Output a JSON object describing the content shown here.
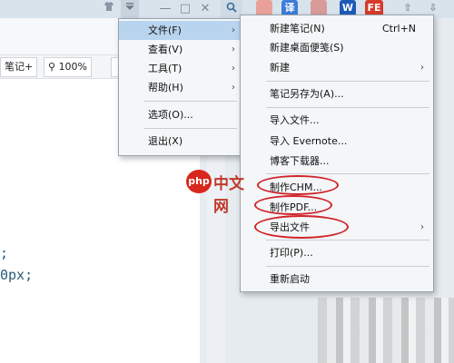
{
  "titlebar": {
    "buttons": [
      "shirt-icon",
      "dropdown-menu-icon",
      "minimize-icon",
      "maximize-icon",
      "close-icon"
    ],
    "minimize_glyph": "—",
    "maximize_glyph": "□",
    "close_glyph": "✕",
    "search_glyph": "🔍",
    "apps": [
      {
        "name": "translate",
        "text": "译",
        "color": "#3b7dd8"
      },
      {
        "name": "word",
        "text": "W",
        "color": "#1e5bb8"
      },
      {
        "name": "flash",
        "text": "FE",
        "color": "#d63b2a"
      }
    ]
  },
  "toolbar": {
    "note_label": "笔记+",
    "zoom_label": "100%",
    "zoom_icon": "🔍"
  },
  "editor": {
    "lines": [
      ";",
      "0px;"
    ]
  },
  "main_menu": {
    "items": [
      {
        "label": "文件(F)",
        "submenu": true,
        "highlight": true
      },
      {
        "label": "查看(V)",
        "submenu": true
      },
      {
        "label": "工具(T)",
        "submenu": true
      },
      {
        "label": "帮助(H)",
        "submenu": true
      },
      {
        "label": "选项(O)...",
        "submenu": false
      },
      {
        "label": "退出(X)",
        "submenu": false
      }
    ]
  },
  "file_menu": {
    "items": [
      {
        "label": "新建笔记(N)",
        "shortcut": "Ctrl+N"
      },
      {
        "label": "新建桌面便笺(S)"
      },
      {
        "label": "新建",
        "submenu": true
      },
      {
        "label": "笔记另存为(A)..."
      },
      {
        "label": "导入文件..."
      },
      {
        "label": "导入 Evernote..."
      },
      {
        "label": "博客下载器..."
      },
      {
        "label": "制作CHM..."
      },
      {
        "label": "制作PDF..."
      },
      {
        "label": "导出文件",
        "submenu": true
      },
      {
        "label": "打印(P)..."
      },
      {
        "label": "重新启动"
      }
    ]
  },
  "watermark": {
    "logo": "php",
    "text": "中文网"
  }
}
